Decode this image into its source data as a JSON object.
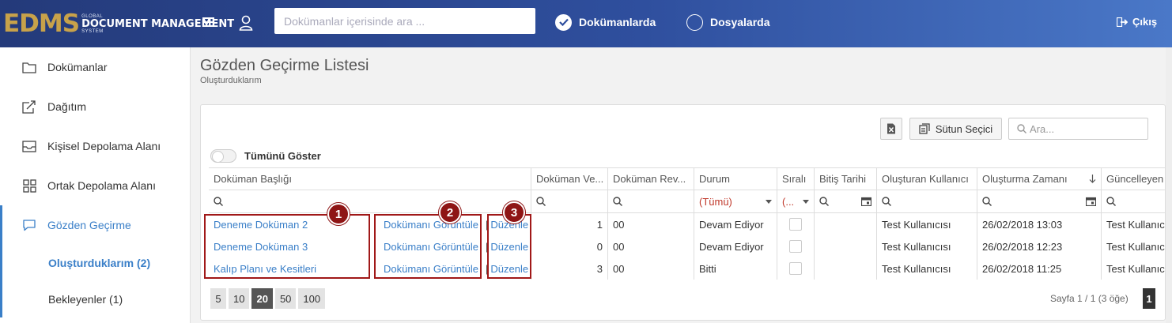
{
  "app": {
    "logo_mark": "EDMS",
    "logo_line1": "GLOBAL",
    "logo_line2": "DOCUMENT MANAGEMENT",
    "logo_line3": "SYSTEM"
  },
  "topbar": {
    "search_placeholder": "Dokümanlar içerisinde ara ...",
    "scope_documents": "Dokümanlarda",
    "scope_files": "Dosyalarda",
    "logout": "Çıkış"
  },
  "sidebar": {
    "items": [
      {
        "label": "Dokümanlar",
        "icon": "folder-icon"
      },
      {
        "label": "Dağıtım",
        "icon": "share-icon"
      },
      {
        "label": "Kişisel Depolama Alanı",
        "icon": "inbox-icon"
      },
      {
        "label": "Ortak Depolama Alanı",
        "icon": "grid-icon"
      },
      {
        "label": "Gözden Geçirme",
        "icon": "chat-icon"
      }
    ],
    "sub_items": [
      {
        "label": "Oluşturduklarım (2)"
      },
      {
        "label": "Bekleyenler (1)"
      }
    ]
  },
  "page": {
    "title": "Gözden Geçirme Listesi",
    "subtitle": "Oluşturduklarım"
  },
  "toolbar": {
    "column_selector": "Sütun Seçici",
    "search_placeholder": "Ara...",
    "show_all": "Tümünü Göster"
  },
  "table": {
    "headers": [
      "Doküman Başlığı",
      "Doküman Ve...",
      "Doküman Rev...",
      "Durum",
      "Sıralı",
      "Bitiş Tarihi",
      "Oluşturan Kullanıcı",
      "Oluşturma Zamanı",
      "Güncelleyen"
    ],
    "filter_durum": "(Tümü)",
    "filter_sirali": "(...",
    "view_label": "Dokümanı Görüntüle",
    "edit_label": "Düzenle",
    "separator": "|",
    "rows": [
      {
        "title": "Deneme Doküman 2",
        "version": "1",
        "revision": "00",
        "status": "Devam Ediyor",
        "end_date": "",
        "creator": "Test Kullanıcısı",
        "created": "26/02/2018 13:03",
        "updater": "Test Kullanıcısı"
      },
      {
        "title": "Deneme Doküman 3",
        "version": "0",
        "revision": "00",
        "status": "Devam Ediyor",
        "end_date": "",
        "creator": "Test Kullanıcısı",
        "created": "26/02/2018 12:23",
        "updater": "Test Kullanıcısı"
      },
      {
        "title": "Kalıp Planı ve Kesitleri",
        "version": "3",
        "revision": "00",
        "status": "Bitti",
        "end_date": "",
        "creator": "Test Kullanıcısı",
        "created": "26/02/2018 11:25",
        "updater": "Test Kullanıcısı"
      }
    ]
  },
  "pagination": {
    "sizes": [
      "5",
      "10",
      "20",
      "50",
      "100"
    ],
    "active_size": "20",
    "info": "Sayfa 1 / 1 (3 öğe)",
    "current_page": "1"
  },
  "annotations": [
    "1",
    "2",
    "3"
  ],
  "colors": {
    "accent": "#3a7fc8",
    "annotation": "#a01818",
    "topbar": "#2f4f9e"
  }
}
